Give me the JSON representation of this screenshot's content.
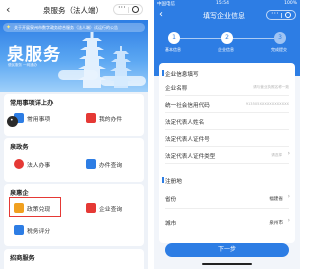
{
  "left": {
    "title": "泉服务（法人端）",
    "notice": "关于开展泉州市数字政务综合服务（法人端）试运行的公告",
    "slogan": "泉服务",
    "slogan_sub": "便民服务 一网通办",
    "sections": [
      {
        "title": "常用事项详上办",
        "items": [
          {
            "label": "常用事项",
            "icon": "doc-icon",
            "color": "#2d7de4"
          },
          {
            "label": "我的办件",
            "icon": "folder-icon",
            "color": "#e53935"
          }
        ]
      },
      {
        "title": "泉政务",
        "items": [
          {
            "label": "法人办事",
            "icon": "person-icon",
            "color": "#e53935"
          },
          {
            "label": "办件查询",
            "icon": "search-icon",
            "color": "#2d7de4"
          }
        ]
      },
      {
        "title": "泉惠企",
        "items": [
          {
            "label": "政策兑现",
            "icon": "policy-icon",
            "color": "#f0a020"
          },
          {
            "label": "企业查询",
            "icon": "enterprise-icon",
            "color": "#e53935"
          },
          {
            "label": "税务评分",
            "icon": "tax-icon",
            "color": "#2d7de4"
          }
        ]
      }
    ],
    "bottom_cut": "招商服务"
  },
  "right": {
    "status": {
      "carrier": "中国电信",
      "time": "15:54",
      "battery": "100%"
    },
    "title": "填写企业信息",
    "steps": [
      {
        "num": "1",
        "label": "基本信息"
      },
      {
        "num": "2",
        "label": "企业信息"
      },
      {
        "num": "3",
        "label": "完成提交"
      }
    ],
    "sec1": "企业信息填写",
    "fields": [
      {
        "label": "企业名称",
        "placeholder": "请与营业执照名称一致"
      },
      {
        "label": "统一社会信用代码",
        "placeholder": "913505XXXXXXXXXXXX"
      },
      {
        "label": "法定代表人姓名",
        "placeholder": ""
      },
      {
        "label": "法定代表人证件号",
        "placeholder": ""
      },
      {
        "label": "法定代表人证件类型",
        "placeholder": "请选择"
      }
    ],
    "sec2": "注册地",
    "region": [
      {
        "label": "省份",
        "value": "福建省"
      },
      {
        "label": "城市",
        "value": "泉州市"
      }
    ],
    "next": "下一步"
  }
}
